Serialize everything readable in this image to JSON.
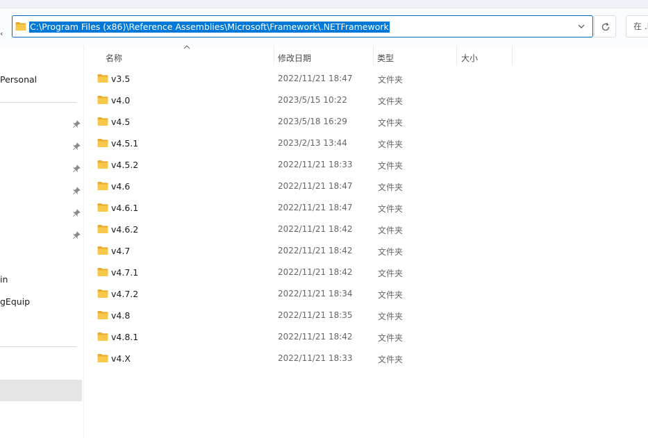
{
  "address": {
    "path": "C:\\Program Files (x86)\\Reference Assemblies\\Microsoft\\Framework\\.NETFramework"
  },
  "search": {
    "placeholder": "在 .N"
  },
  "sidebar": {
    "items": [
      {
        "label": "Personal"
      },
      {
        "label": "in"
      },
      {
        "label": "gEquip"
      }
    ]
  },
  "columns": {
    "name": "名称",
    "date": "修改日期",
    "type": "类型",
    "size": "大小"
  },
  "files": [
    {
      "name": "v3.5",
      "date": "2022/11/21 18:47",
      "type": "文件夹"
    },
    {
      "name": "v4.0",
      "date": "2023/5/15 10:22",
      "type": "文件夹"
    },
    {
      "name": "v4.5",
      "date": "2023/5/18 16:29",
      "type": "文件夹"
    },
    {
      "name": "v4.5.1",
      "date": "2023/2/13 13:44",
      "type": "文件夹"
    },
    {
      "name": "v4.5.2",
      "date": "2022/11/21 18:33",
      "type": "文件夹"
    },
    {
      "name": "v4.6",
      "date": "2022/11/21 18:47",
      "type": "文件夹"
    },
    {
      "name": "v4.6.1",
      "date": "2022/11/21 18:47",
      "type": "文件夹"
    },
    {
      "name": "v4.6.2",
      "date": "2022/11/21 18:42",
      "type": "文件夹"
    },
    {
      "name": "v4.7",
      "date": "2022/11/21 18:42",
      "type": "文件夹"
    },
    {
      "name": "v4.7.1",
      "date": "2022/11/21 18:42",
      "type": "文件夹"
    },
    {
      "name": "v4.7.2",
      "date": "2022/11/21 18:34",
      "type": "文件夹"
    },
    {
      "name": "v4.8",
      "date": "2022/11/21 18:35",
      "type": "文件夹"
    },
    {
      "name": "v4.8.1",
      "date": "2022/11/21 18:42",
      "type": "文件夹"
    },
    {
      "name": "v4.X",
      "date": "2022/11/21 18:33",
      "type": "文件夹"
    }
  ],
  "colors": {
    "selection": "#0078d7",
    "folder": "#f8c84a",
    "accent_border": "#0067c0"
  },
  "icons": {
    "folder": "folder-icon",
    "pin": "pin-icon",
    "refresh": "refresh-icon",
    "dropdown": "chevron-down-icon",
    "sort": "sort-ascending-icon"
  }
}
